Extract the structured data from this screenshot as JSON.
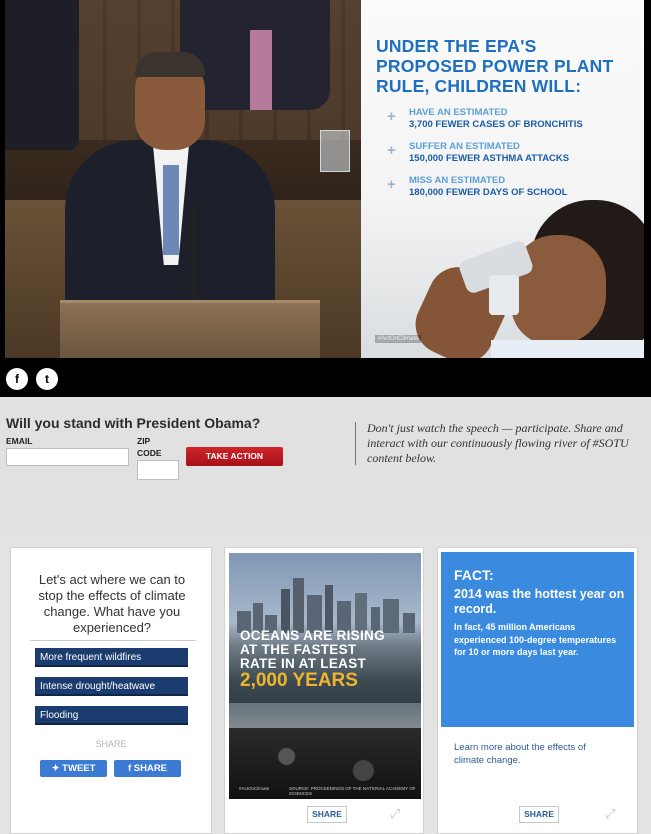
{
  "hero": {
    "infographic": {
      "headline": "UNDER THE EPA'S PROPOSED POWER PLANT RULE, CHILDREN WILL:",
      "bullets": [
        {
          "line1": "HAVE AN ESTIMATED",
          "line2": "3,700 FEWER CASES OF BRONCHITIS"
        },
        {
          "line1": "SUFFER AN ESTIMATED",
          "line2": "150,000 FEWER ASTHMA ATTACKS"
        },
        {
          "line1": "MISS AN ESTIMATED",
          "line2": "180,000 FEWER DAYS OF SCHOOL"
        }
      ],
      "hashtag": "#ActOnClimate"
    },
    "social": {
      "facebook": "f",
      "twitter": "t"
    }
  },
  "action": {
    "question": "Will you stand with President Obama?",
    "email_label": "EMAIL",
    "zip_label": "ZIP CODE",
    "email_value": "",
    "zip_value": "",
    "button": "TAKE ACTION",
    "blurb": "Don't just watch the speech — participate. Share and interact with our continuously flowing river of #SOTU content below."
  },
  "cards": {
    "poll": {
      "prompt": "Let's act where we can to stop the effects of climate change. What have you experienced?",
      "options": [
        "More frequent wildfires",
        "Intense drought/heatwave",
        "Flooding"
      ],
      "share_label": "SHARE",
      "tweet": "TWEET",
      "fshare": "SHARE"
    },
    "oceans": {
      "text_top": "OCEANS ARE RISING AT THE FASTEST RATE IN AT LEAST",
      "text_big": "2,000 YEARS",
      "tag": "#ActOnClimate",
      "credit": "SOURCE: PROCEEDINGS OF THE NATIONAL ACADEMY OF SCIENCES",
      "share": "SHARE"
    },
    "fact": {
      "heading": "FACT:",
      "bold": "2014 was the hottest year on record.",
      "detail": "In fact, 45 million Americans experienced 100-degree temperatures for 10 or more days last year.",
      "learn": "Learn more about the effects of climate change.",
      "share": "SHARE"
    }
  },
  "colors": {
    "accent_blue": "#3b7bd4",
    "action_red": "#c0121a",
    "poll_navy": "#1b3c6e",
    "fact_blue": "#3a8be0",
    "ocean_gold": "#f0b52a"
  }
}
